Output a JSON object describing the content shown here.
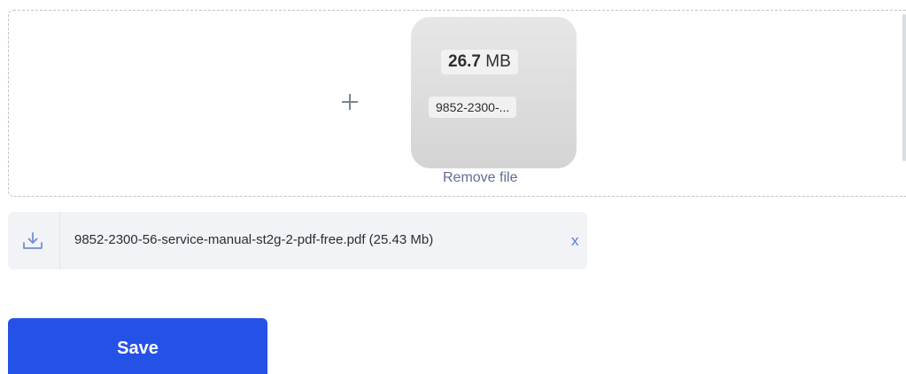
{
  "upload": {
    "add_icon": "plus-icon",
    "preview": {
      "size_value": "26.7",
      "size_unit": "MB",
      "file_name_truncated": "9852-2300-...",
      "remove_label": "Remove file"
    }
  },
  "attachment": {
    "icon": "download-icon",
    "file_label": "9852-2300-56-service-manual-st2g-2-pdf-free.pdf (25.43 Mb)",
    "remove_label": "x"
  },
  "actions": {
    "save_label": "Save"
  },
  "colors": {
    "primary": "#2451e6",
    "link": "#5f6f91",
    "close": "#5b7bd6"
  }
}
